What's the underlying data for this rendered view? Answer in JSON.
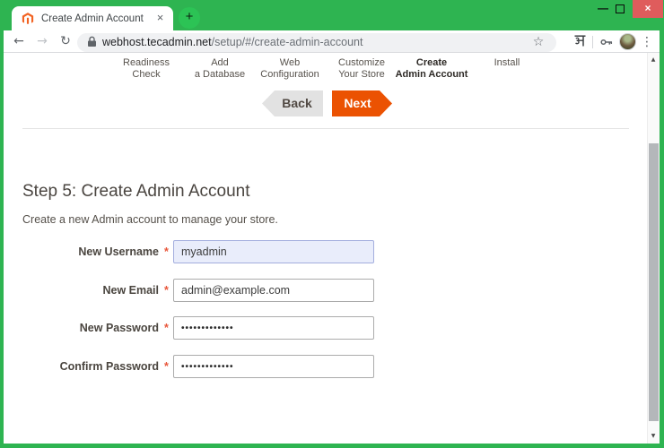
{
  "browser": {
    "tab_title": "Create Admin Account",
    "url": {
      "domain": "webhost.tecadmin.net",
      "path": "/setup/#/create-admin-account"
    }
  },
  "icons": {
    "back": "←",
    "forward": "→",
    "reload": "↻",
    "star": "☆",
    "menu": "⋮",
    "tab_close": "×",
    "new_tab": "+",
    "window_min": "—",
    "window_close": "×",
    "scroll_up": "▲",
    "scroll_down": "▼"
  },
  "page": {
    "stepper": [
      {
        "line1": "Readiness",
        "line2": "Check"
      },
      {
        "line1": "Add",
        "line2": "a Database"
      },
      {
        "line1": "Web",
        "line2": "Configuration"
      },
      {
        "line1": "Customize",
        "line2": "Your Store"
      },
      {
        "line1": "Create",
        "line2": "Admin Account"
      },
      {
        "line1": "Install",
        "line2": ""
      }
    ],
    "back_label": "Back",
    "next_label": "Next",
    "heading": "Step 5: Create Admin Account",
    "subtitle": "Create a new Admin account to manage your store.",
    "form": {
      "fields": [
        {
          "label": "New Username",
          "required": "*",
          "value": "myadmin"
        },
        {
          "label": "New Email",
          "required": "*",
          "value": "admin@example.com"
        },
        {
          "label": "New Password",
          "required": "*",
          "value": "•••••••••••••"
        },
        {
          "label": "Confirm Password",
          "required": "*",
          "value": "•••••••••••••"
        }
      ]
    }
  },
  "colors": {
    "theme_green": "#2eb451",
    "accent_orange": "#eb5202",
    "close_red": "#df5c5c",
    "magento_orange": "#f26322",
    "focused_input_bg": "#e9edfb"
  }
}
